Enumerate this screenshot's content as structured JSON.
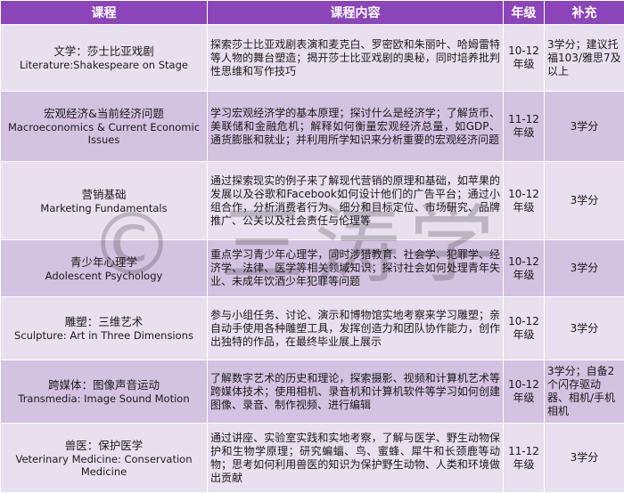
{
  "header": {
    "course": "课程",
    "content": "课程内容",
    "grade": "年级",
    "note": "补充"
  },
  "rows": [
    {
      "zh": "文学：莎士比亚戏剧",
      "en": "Literature:Shakespeare on Stage",
      "desc": "探索莎士比亚戏剧表演和麦克白、罗密欧和朱丽叶、哈姆雷特等人物的舞台塑造；揭开莎士比亚戏剧的奥秘，同时培养批判性思维和写作技巧",
      "grade": "10-12年级",
      "note": "3学分；建议托福103/雅思7及以上"
    },
    {
      "zh": "宏观经济&当前经济问题",
      "en": "Macroeconomics & Current Economic Issues",
      "desc": "学习宏观经济学的基本原理；探讨什么是经济学；了解货币、美联储和金融危机；解释如何衡量宏观经济总量，如GDP、通货膨胀和就业；并利用所学知识来分析重要的宏观经济问题",
      "grade": "11-12年级",
      "note": "3学分"
    },
    {
      "zh": "营销基础",
      "en": "Marketing Fundamentals",
      "desc": "通过探索现实的例子来了解现代营销的原理和基础，如苹果的发展以及谷歌和Facebook如何设计他们的广告平台；通过小组合作，分析消费者行为、细分和目标定位、市场研究、品牌推广、公关以及社会责任与伦理等",
      "grade": "10-12年级",
      "note": "3学分"
    },
    {
      "zh": "青少年心理学",
      "en": "Adolescent Psychology",
      "desc": "重点学习青少年心理学，同时涉猎教育、社会学、犯罪学、经济学、法律、医学等相关领域知识；探讨社会如何处理青年失业、未成年饮酒少年犯罪等问题",
      "grade": "10-12年级",
      "note": "3学分"
    },
    {
      "zh": "雕塑：三维艺术",
      "en": "Sculpture: Art in Three Dimensions",
      "desc": "参与小组任务、讨论、演示和博物馆实地考察来学习雕塑；亲自动手使用各种雕塑工具，发挥创造力和团队协作能力，创作出独特的作品，在最终毕业展上展示",
      "grade": "10-12年级",
      "note": "3学分"
    },
    {
      "zh": "跨媒体：图像声音运动",
      "en": "Transmedia: Image Sound Motion",
      "desc": "了解数字艺术的历史和理论，探索摄影、视频和计算机艺术等跨媒体技术；使用相机、录音机和计算机软件等学习如何创建图像、录音、制作视频、进行编辑",
      "grade": "10-12年级",
      "note": "3学分；自备2个闪存驱动器、相机/手机相机"
    },
    {
      "zh": "兽医：保护医学",
      "en": "Veterinary Medicine: Conservation Medicine",
      "desc": "通过讲座、实验室实践和实地考察，了解与医学、野生动物保护和生物学原理；研究蝙蝠、鸟、蜜蜂、犀牛和长颈鹿等动物；思考如何利用兽医的知识为保护野生动物、人类和环境做出贡献",
      "grade": "11-12年级",
      "note": "3学分"
    }
  ],
  "watermark": "© 三涛学"
}
